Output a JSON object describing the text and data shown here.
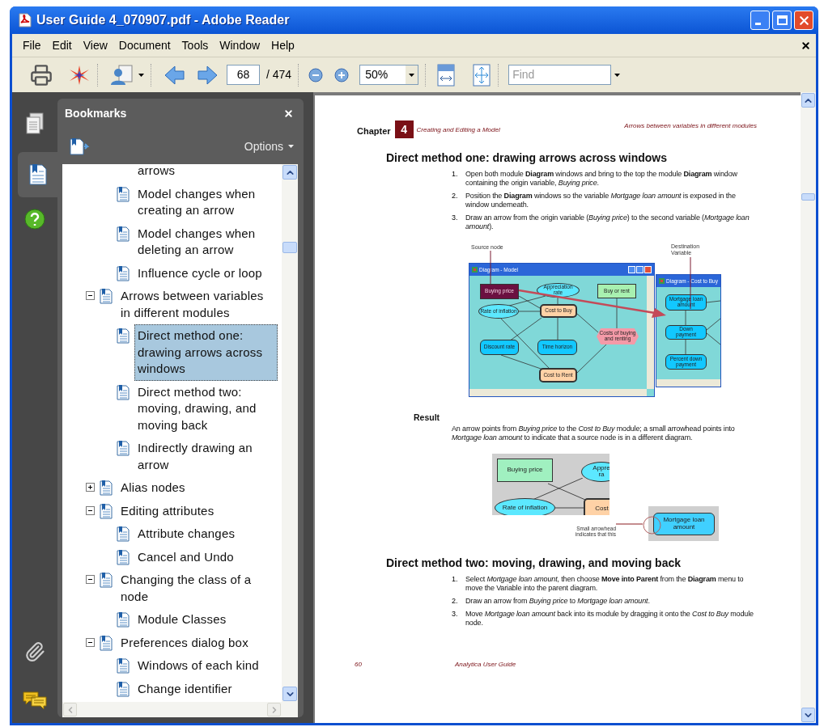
{
  "window": {
    "title": "User Guide 4_070907.pdf - Adobe Reader"
  },
  "menu": [
    "File",
    "Edit",
    "View",
    "Document",
    "Tools",
    "Window",
    "Help"
  ],
  "toolbar": {
    "page": "68",
    "page_count": "/ 474",
    "zoom": "50%",
    "find": {
      "placeholder": "Find"
    }
  },
  "nav_tabs": [
    {
      "selected": false
    },
    {
      "selected": true
    }
  ],
  "bookmarks": {
    "title": "Bookmarks",
    "options": "Options",
    "items": [
      {
        "children": [
          {
            "label": "arrows",
            "icon": false,
            "selected": false
          },
          {
            "label": "Model changes when creating an arrow",
            "selected": false
          },
          {
            "label": "Model changes when deleting an arrow",
            "selected": false
          },
          {
            "label": "Influence cycle or loop",
            "selected": false
          }
        ]
      },
      {
        "label": "Arrows between variables in different modules",
        "selected": false,
        "expanded": true,
        "children": [
          {
            "label": "Direct method one: drawing arrows across windows",
            "selected": true
          },
          {
            "label": "Direct method two: moving, drawing, and moving back",
            "selected": false
          },
          {
            "label": "Indirectly drawing an arrow",
            "selected": false
          }
        ]
      },
      {
        "label": "Alias nodes",
        "selected": false,
        "expanded": false
      },
      {
        "label": "Editing attributes",
        "selected": false,
        "expanded": true,
        "children": [
          {
            "label": "Attribute changes",
            "selected": false
          },
          {
            "label": "Cancel and Undo",
            "selected": false
          }
        ]
      },
      {
        "label": "Changing the class of a node",
        "selected": false,
        "expanded": true,
        "children": [
          {
            "label": "Module Classes",
            "selected": false
          }
        ]
      },
      {
        "label": "Preferences dialog box",
        "selected": false,
        "expanded": true,
        "children": [
          {
            "label": "Windows of each kind",
            "selected": false
          },
          {
            "label": "Change identifier",
            "selected": false
          }
        ]
      }
    ]
  },
  "document": {
    "chapter_label": "Chapter",
    "chapter_number": "4",
    "chapter_title": "Creating and Editing a Model",
    "section_title": "Arrows between variables in different modules",
    "heading_1": "Direct method one: drawing arrows across windows",
    "steps_1": [
      {
        "number": "1.",
        "text": "Open both module **Diagram** windows and bring to the top the module **Diagram** window containing the origin variable, *Buying price*."
      },
      {
        "number": "2.",
        "text": "Position the **Diagram** windows so the variable *Mortgage loan amount* is exposed in the window underneath."
      },
      {
        "number": "3.",
        "text": "Draw an arrow from the origin variable (*Buying price*) to the second variable (*Mortgage loan amount*)."
      }
    ],
    "figure_1": {
      "source_label": "Source node",
      "destination_label": "Destination Variable",
      "windows": [
        {
          "title": "Diagram - Model",
          "nodes": [
            {
              "label": "Buying price",
              "kind": "rect",
              "color": "#6b1040"
            },
            {
              "label": "Appreciation\nrate",
              "kind": "ellipse",
              "color": "#5ce8ff"
            },
            {
              "label": "Buy or rent",
              "kind": "rect",
              "color": "#a8f0b0"
            },
            {
              "label": "Rate of inflation",
              "kind": "ellipse",
              "color": "#5ce8ff"
            },
            {
              "label": "Cost to Buy",
              "kind": "module",
              "color": "#ffd2a6"
            },
            {
              "label": "Costs of buying\nand renting",
              "kind": "hexagon",
              "color": "#f49aa8"
            },
            {
              "label": "Discount rate",
              "kind": "rounded",
              "color": "#12c8ff"
            },
            {
              "label": "Time horizon",
              "kind": "rounded",
              "color": "#12c8ff"
            },
            {
              "label": "Cost to Rent",
              "kind": "module",
              "color": "#ffd2a6"
            }
          ]
        },
        {
          "title": "Diagram - Cost to Buy",
          "nodes": [
            {
              "label": "Mortgage loan\namount",
              "kind": "rounded",
              "color": "#12c8ff"
            },
            {
              "label": "Down\npayment",
              "kind": "rounded",
              "color": "#12c8ff"
            },
            {
              "label": "Percent down\npayment",
              "kind": "rounded",
              "color": "#12c8ff"
            }
          ]
        }
      ]
    },
    "result_label": "Result",
    "result_text": "An arrow points from *Buying price* to the *Cost to Buy* module; a small arrowhead points into *Mortgage loan amount* to indicate that a source node is in a different diagram.",
    "figure_2": {
      "nodes": [
        {
          "label": "Buying price",
          "kind": "rect",
          "color": "#a0f0c0"
        },
        {
          "label": "Appre\nra",
          "kind": "ellipse",
          "color": "#5ce8ff"
        },
        {
          "label": "Rate of inflation",
          "kind": "ellipse",
          "color": "#5ce8ff"
        },
        {
          "label": "Cost",
          "kind": "module",
          "color": "#ffd2a6"
        }
      ],
      "inset_nodes": [
        {
          "label": "Mortgage loan\namount",
          "kind": "rounded",
          "color": "#40d0ff"
        }
      ],
      "callout": "Small arrowhead\nindicates that this"
    },
    "heading_2": "Direct method two: moving, drawing, and moving back",
    "steps_2": [
      {
        "number": "1.",
        "text": "Select *Mortgage loan amount*, then choose **Move into Parent** from the **Diagram** menu to move the Variable into the parent diagram."
      },
      {
        "number": "2.",
        "text": "Draw an arrow from *Buying price* to *Mortgage loan amount*."
      },
      {
        "number": "3.",
        "text": "Move *Mortgage loan amount* back into its module by dragging it onto the *Cost to Buy* module node."
      }
    ],
    "footer": {
      "page": "60",
      "title": "Analytica User Guide"
    }
  }
}
